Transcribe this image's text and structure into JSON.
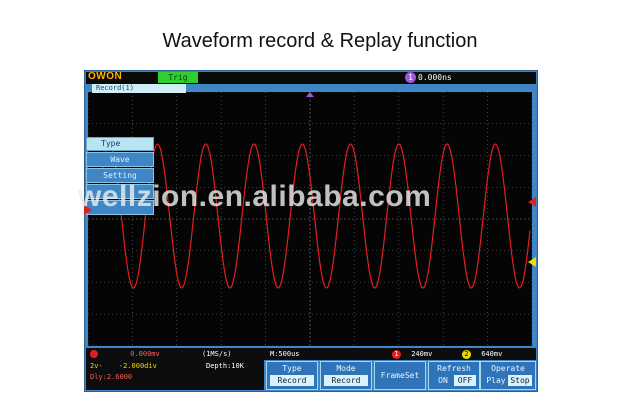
{
  "page_title": "Waveform record & Replay function",
  "watermark": "wellzion.en.alibaba.com",
  "scope": {
    "logo": "OWON",
    "trigger_status": "Trig",
    "time_position_badge": "1",
    "time_position": "0.000ns",
    "record_tag": "Record(1)",
    "menu": {
      "header": "Type",
      "items": [
        "Wave",
        "Setting",
        "",
        ""
      ]
    },
    "status": {
      "ch1_volts": "0.000mv",
      "ch2_label": "2v-",
      "ch2_volts": "-2.000div",
      "ch3_label": "Dly:2.6000",
      "sample_rate": "(1MS/s)",
      "depth": "Depth:10K",
      "timebase": "M:500us",
      "trig1_badge": "1",
      "trig1_value": "240mv",
      "trig2_badge": "2",
      "trig2_value": "640mv"
    },
    "softkeys": [
      {
        "label": "Type",
        "value": "Record"
      },
      {
        "label": "Mode",
        "value": "Record"
      },
      {
        "label": "FrameSet",
        "value": ""
      },
      {
        "label": "Refresh",
        "value_a": "ON",
        "value_b": "OFF"
      },
      {
        "label": "Operate",
        "value_a": "Play",
        "value_b": "Stop"
      }
    ],
    "colors": {
      "trace": "#e31e1e",
      "frame": "#3f86c6",
      "trigger_green": "#2fcf2f",
      "ch2_yellow": "#f2d900"
    }
  }
}
